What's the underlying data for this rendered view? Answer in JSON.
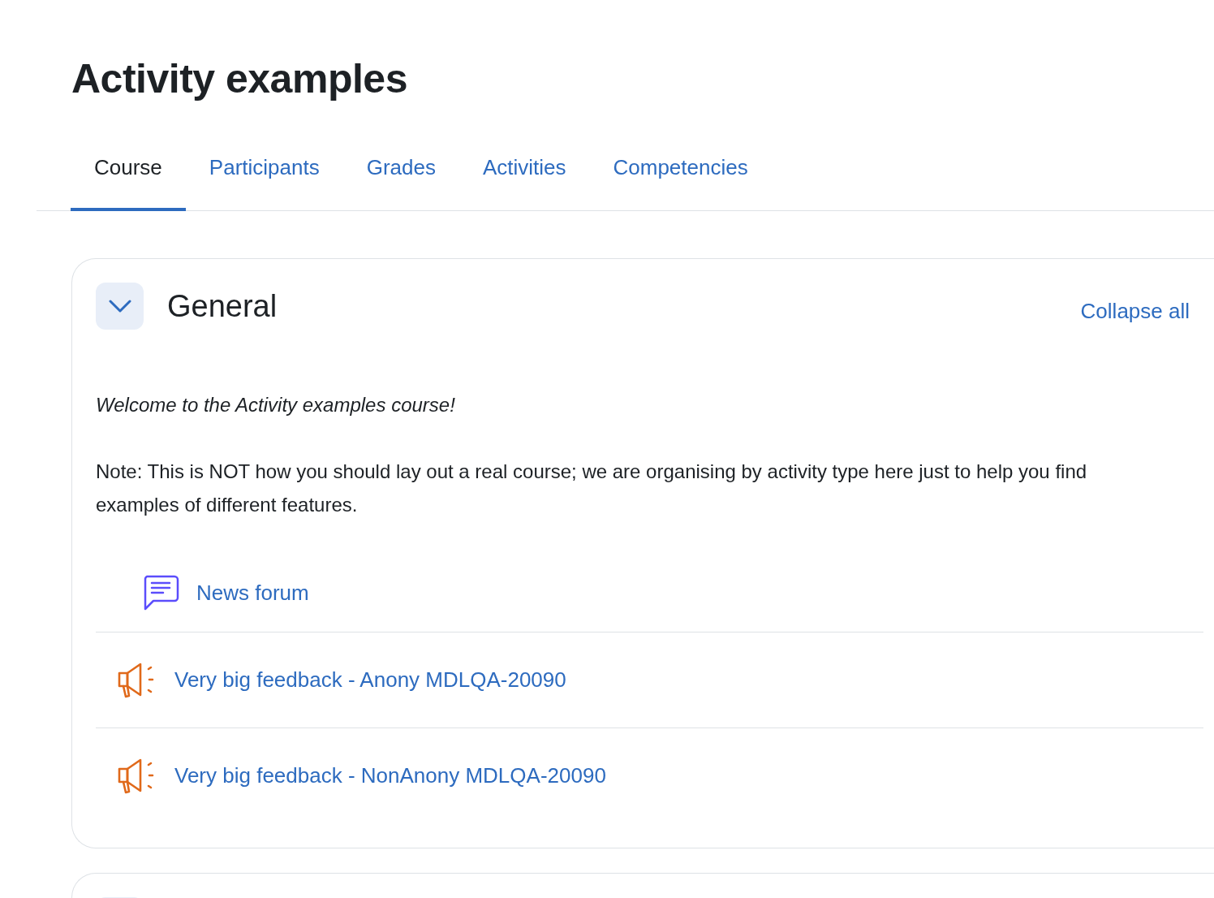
{
  "page": {
    "title": "Activity examples"
  },
  "tabs": [
    {
      "label": "Course",
      "selected": true
    },
    {
      "label": "Participants",
      "selected": false
    },
    {
      "label": "Grades",
      "selected": false
    },
    {
      "label": "Activities",
      "selected": false
    },
    {
      "label": "Competencies",
      "selected": false
    }
  ],
  "sections": [
    {
      "kind": "full",
      "title": "General",
      "expanded": true,
      "collapse_link": "Collapse all",
      "summary": [
        {
          "text": "Welcome to the Activity examples course!",
          "italic": true
        },
        {
          "text": "Note: This is NOT how you should lay out a real course; we are organising by activity type here just to help you find examples of different features.",
          "italic": false
        }
      ],
      "activities": [
        {
          "kind": "forum",
          "name": "News forum"
        },
        {
          "kind": "feedback",
          "name": "Very big feedback - Anony MDLQA-20090"
        },
        {
          "kind": "feedback",
          "name": "Very big feedback - NonAnony MDLQA-20090"
        }
      ]
    },
    {
      "kind": "partial"
    }
  ]
}
